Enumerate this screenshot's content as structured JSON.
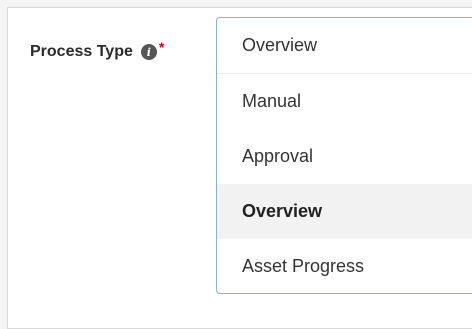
{
  "field": {
    "label": "Process Type",
    "info_glyph": "i",
    "info_icon": "info-circle-icon",
    "required_mark": "*"
  },
  "dropdown": {
    "current_value": "Overview",
    "options": [
      {
        "label": "Manual",
        "selected": false
      },
      {
        "label": "Approval",
        "selected": false
      },
      {
        "label": "Overview",
        "selected": true
      },
      {
        "label": "Asset Progress",
        "selected": false
      }
    ]
  },
  "colors": {
    "required": "#d0021b",
    "focus_border": "#8fb0cf",
    "selected_bg": "#f2f2f2"
  }
}
